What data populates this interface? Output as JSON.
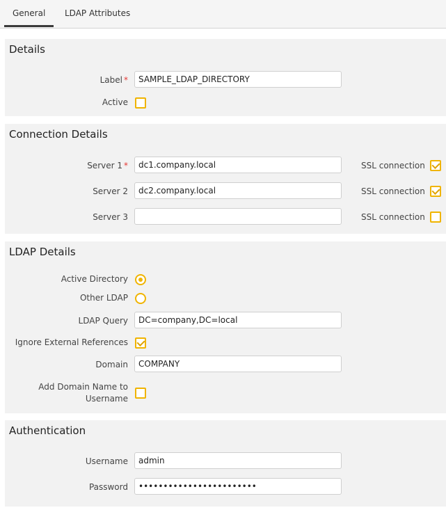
{
  "tabs": [
    {
      "label": "General",
      "active": true
    },
    {
      "label": "LDAP Attributes",
      "active": false
    }
  ],
  "details": {
    "title": "Details",
    "label_label": "Label",
    "required_mark": "*",
    "label_value": "SAMPLE_LDAP_DIRECTORY",
    "active_label": "Active",
    "active_checked": false
  },
  "connection": {
    "title": "Connection Details",
    "servers": [
      {
        "label": "Server 1",
        "required": true,
        "value": "dc1.company.local",
        "ssl_label": "SSL connection",
        "ssl_checked": true
      },
      {
        "label": "Server 2",
        "required": false,
        "value": "dc2.company.local",
        "ssl_label": "SSL connection",
        "ssl_checked": true
      },
      {
        "label": "Server 3",
        "required": false,
        "value": "",
        "ssl_label": "SSL connection",
        "ssl_checked": false
      }
    ]
  },
  "ldap": {
    "title": "LDAP Details",
    "active_directory_label": "Active Directory",
    "active_directory_selected": true,
    "other_ldap_label": "Other LDAP",
    "other_ldap_selected": false,
    "query_label": "LDAP Query",
    "query_value": "DC=company,DC=local",
    "ignore_refs_label": "Ignore External References",
    "ignore_refs_checked": true,
    "domain_label": "Domain",
    "domain_value": "COMPANY",
    "add_domain_label": "Add Domain Name to Username",
    "add_domain_checked": false
  },
  "auth": {
    "title": "Authentication",
    "username_label": "Username",
    "username_value": "admin",
    "password_label": "Password",
    "password_value": "••••••••••••••••••••••••"
  },
  "colors": {
    "accent": "#f0b400",
    "required": "#e53935",
    "section_bg": "#f2f2f2"
  }
}
